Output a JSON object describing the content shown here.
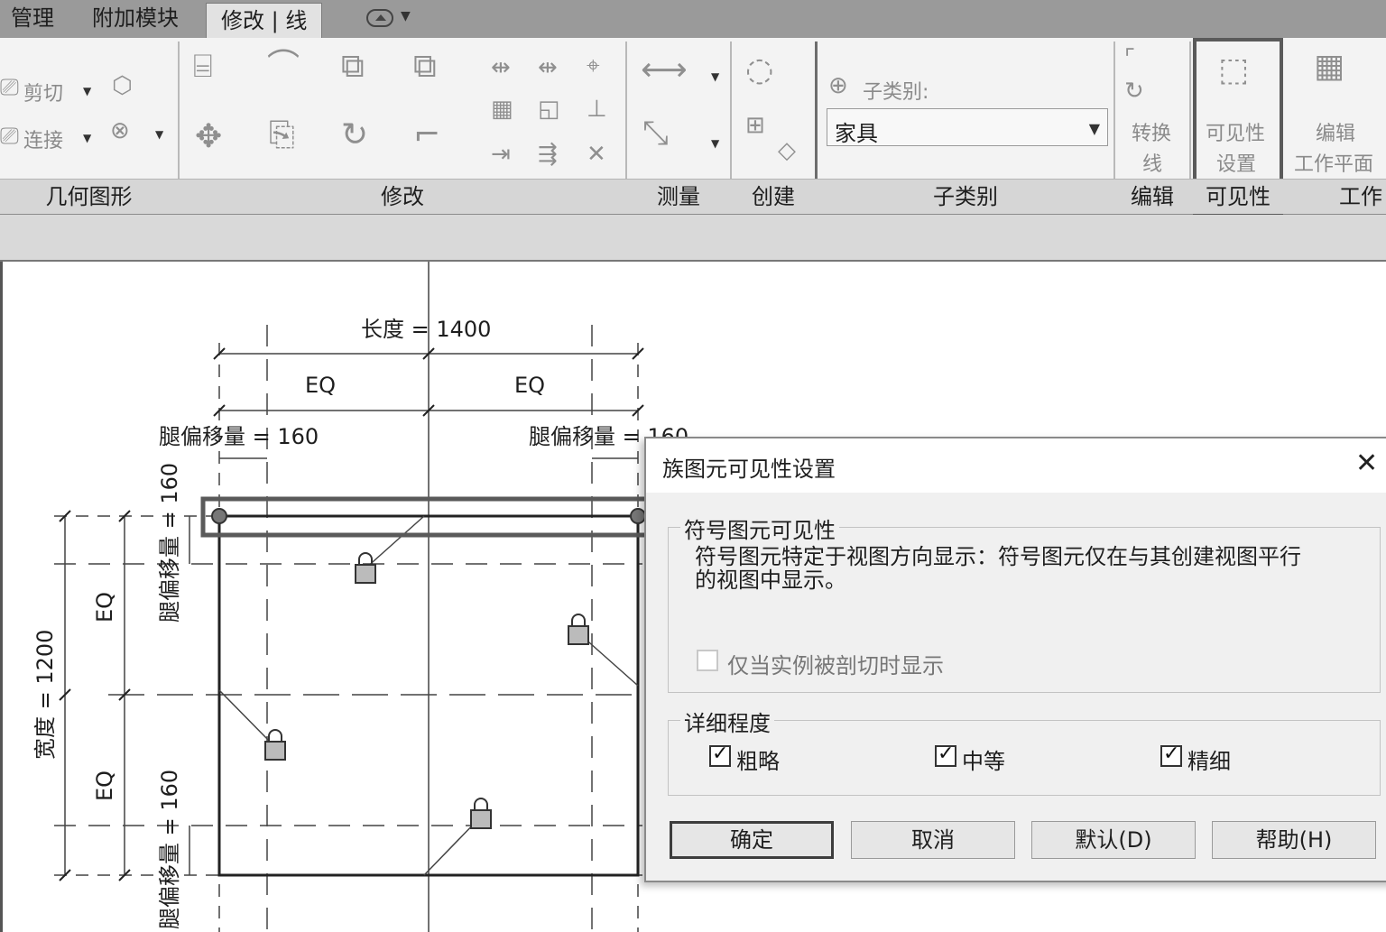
{
  "tabs": [
    {
      "label": "管理"
    },
    {
      "label": "附加模块"
    },
    {
      "label": "修改 | 线",
      "active": true
    }
  ],
  "ribbon": {
    "geometry": {
      "cut_label": "剪切",
      "join_label": "连接",
      "panel_label": "几何图形"
    },
    "modify": {
      "panel_label": "修改"
    },
    "measure": {
      "panel_label": "测量"
    },
    "create": {
      "panel_label": "创建"
    },
    "subcategory": {
      "title": "子类别:",
      "selected": "家具",
      "panel_label": "子类别"
    },
    "edit": {
      "button_label_1": "转换",
      "button_label_2": "线",
      "panel_label": "编辑"
    },
    "visibility": {
      "button_label_1": "可见性",
      "button_label_2": "设置",
      "panel_label": "可见性"
    },
    "workplane": {
      "button_label_1": "编辑",
      "button_label_2": "工作平面",
      "panel_label": "工作"
    }
  },
  "drawing": {
    "length_dim": "长度 = 1400",
    "eq_label": "EQ",
    "leg_offset_label": "腿偏移量 = 160",
    "leg_offset_label_right": "腿偏移量 = 160",
    "width_dim": "宽度 = 1200",
    "leg_offset_vertical": "腿偏移量 = 160"
  },
  "dialog": {
    "title": "族图元可见性设置",
    "close_glyph": "✕",
    "symbolic_group": {
      "legend": "符号图元可见性",
      "note_line1": "符号图元特定于视图方向显示：符号图元仅在与其创建视图平行",
      "note_line2": "的视图中显示。",
      "cut_only_label": "仅当实例被剖切时显示",
      "cut_only_checked": false
    },
    "detail_group": {
      "legend": "详细程度",
      "options": [
        {
          "label": "粗略",
          "checked": true
        },
        {
          "label": "中等",
          "checked": true
        },
        {
          "label": "精细",
          "checked": true
        }
      ]
    },
    "buttons": {
      "ok": "确定",
      "cancel": "取消",
      "default": "默认(D)",
      "help": "帮助(H)"
    }
  },
  "colors": {
    "ribbon_bg": "#f3f3f3",
    "tabbar_bg": "#9a9a9a",
    "dialog_bg": "#f0f0f0",
    "highlight": "#5a5a5a"
  }
}
